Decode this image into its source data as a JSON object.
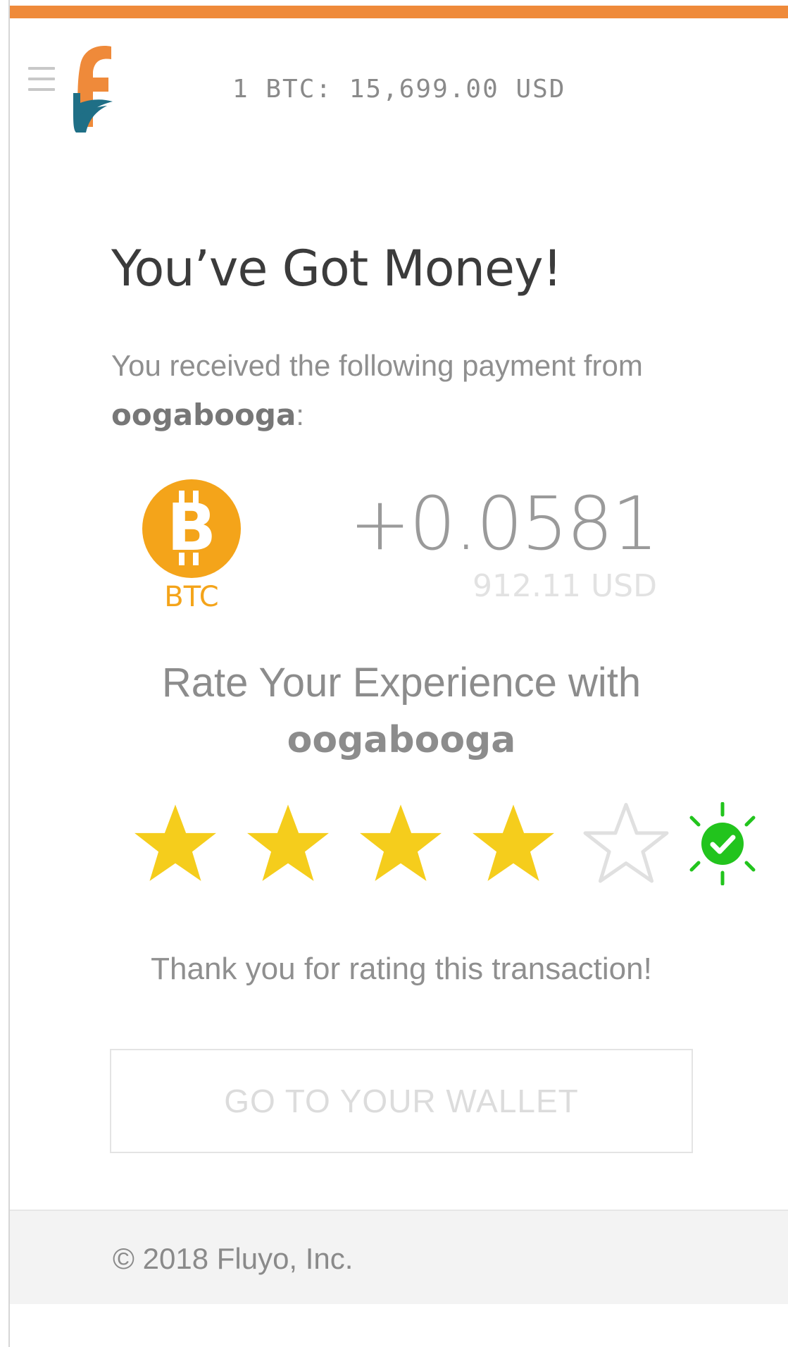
{
  "header": {
    "rate_text": "1 BTC: 15,699.00 USD",
    "menu_icon": "hamburger-menu-icon",
    "logo_icon": "fluyo-logo"
  },
  "main": {
    "title": "You’ve Got Money!",
    "message_prefix": "You received the following payment from ",
    "sender": "oogabooga",
    "message_suffix": ":",
    "currency_icon": "bitcoin-coin-icon",
    "currency_code": "BTC",
    "amount": "+0.0581",
    "amount_usd": "912.11 USD",
    "rate_heading": "Rate Your Experience with",
    "rate_user": "oogabooga",
    "rating": {
      "value": 4,
      "max": 5
    },
    "rating_confirm_icon": "check-circle-icon",
    "thanks": "Thank you for rating this transaction!",
    "wallet_button": "GO TO YOUR WALLET"
  },
  "footer": {
    "copyright": "© 2018 Fluyo, Inc."
  },
  "colors": {
    "accent_orange": "#ef8a3a",
    "bitcoin": "#f4a41a",
    "star_filled": "#f5cd1c",
    "star_empty": "#e0e0e0",
    "success_green": "#22c41d"
  }
}
